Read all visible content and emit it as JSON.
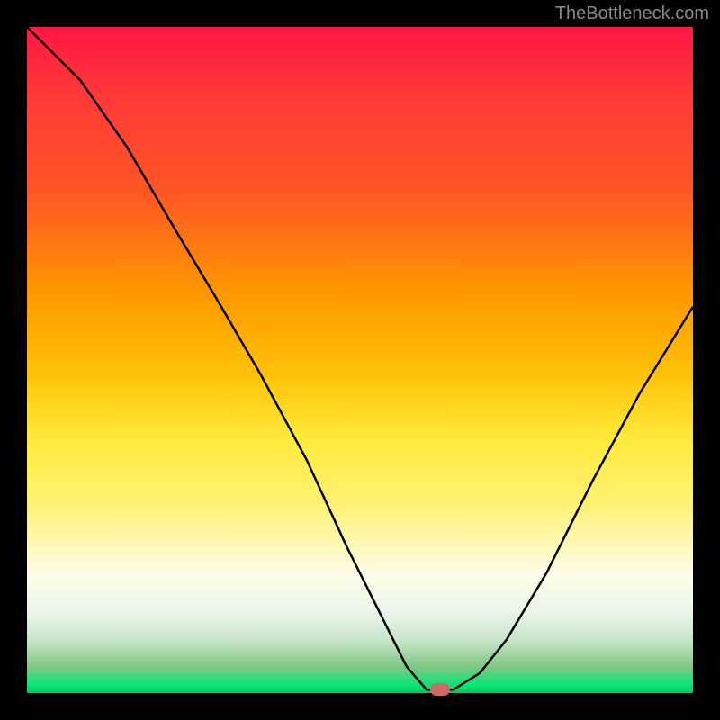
{
  "attribution": "TheBottleneck.com",
  "chart_data": {
    "type": "line",
    "title": "",
    "xlabel": "",
    "ylabel": "",
    "xlim": [
      0,
      100
    ],
    "ylim": [
      0,
      100
    ],
    "curve": [
      {
        "x": 0,
        "y": 100
      },
      {
        "x": 8,
        "y": 92
      },
      {
        "x": 15,
        "y": 82
      },
      {
        "x": 22,
        "y": 70
      },
      {
        "x": 28,
        "y": 60
      },
      {
        "x": 35,
        "y": 48
      },
      {
        "x": 42,
        "y": 35
      },
      {
        "x": 48,
        "y": 22
      },
      {
        "x": 53,
        "y": 12
      },
      {
        "x": 57,
        "y": 4
      },
      {
        "x": 60,
        "y": 0.5
      },
      {
        "x": 64,
        "y": 0.5
      },
      {
        "x": 68,
        "y": 3
      },
      {
        "x": 72,
        "y": 8
      },
      {
        "x": 78,
        "y": 18
      },
      {
        "x": 85,
        "y": 32
      },
      {
        "x": 92,
        "y": 45
      },
      {
        "x": 100,
        "y": 58
      }
    ],
    "marker": {
      "x": 62,
      "y": 0.5
    },
    "gradient_colors": {
      "top": "#ff1744",
      "mid": "#ffeb3b",
      "bottom": "#00c853"
    }
  }
}
